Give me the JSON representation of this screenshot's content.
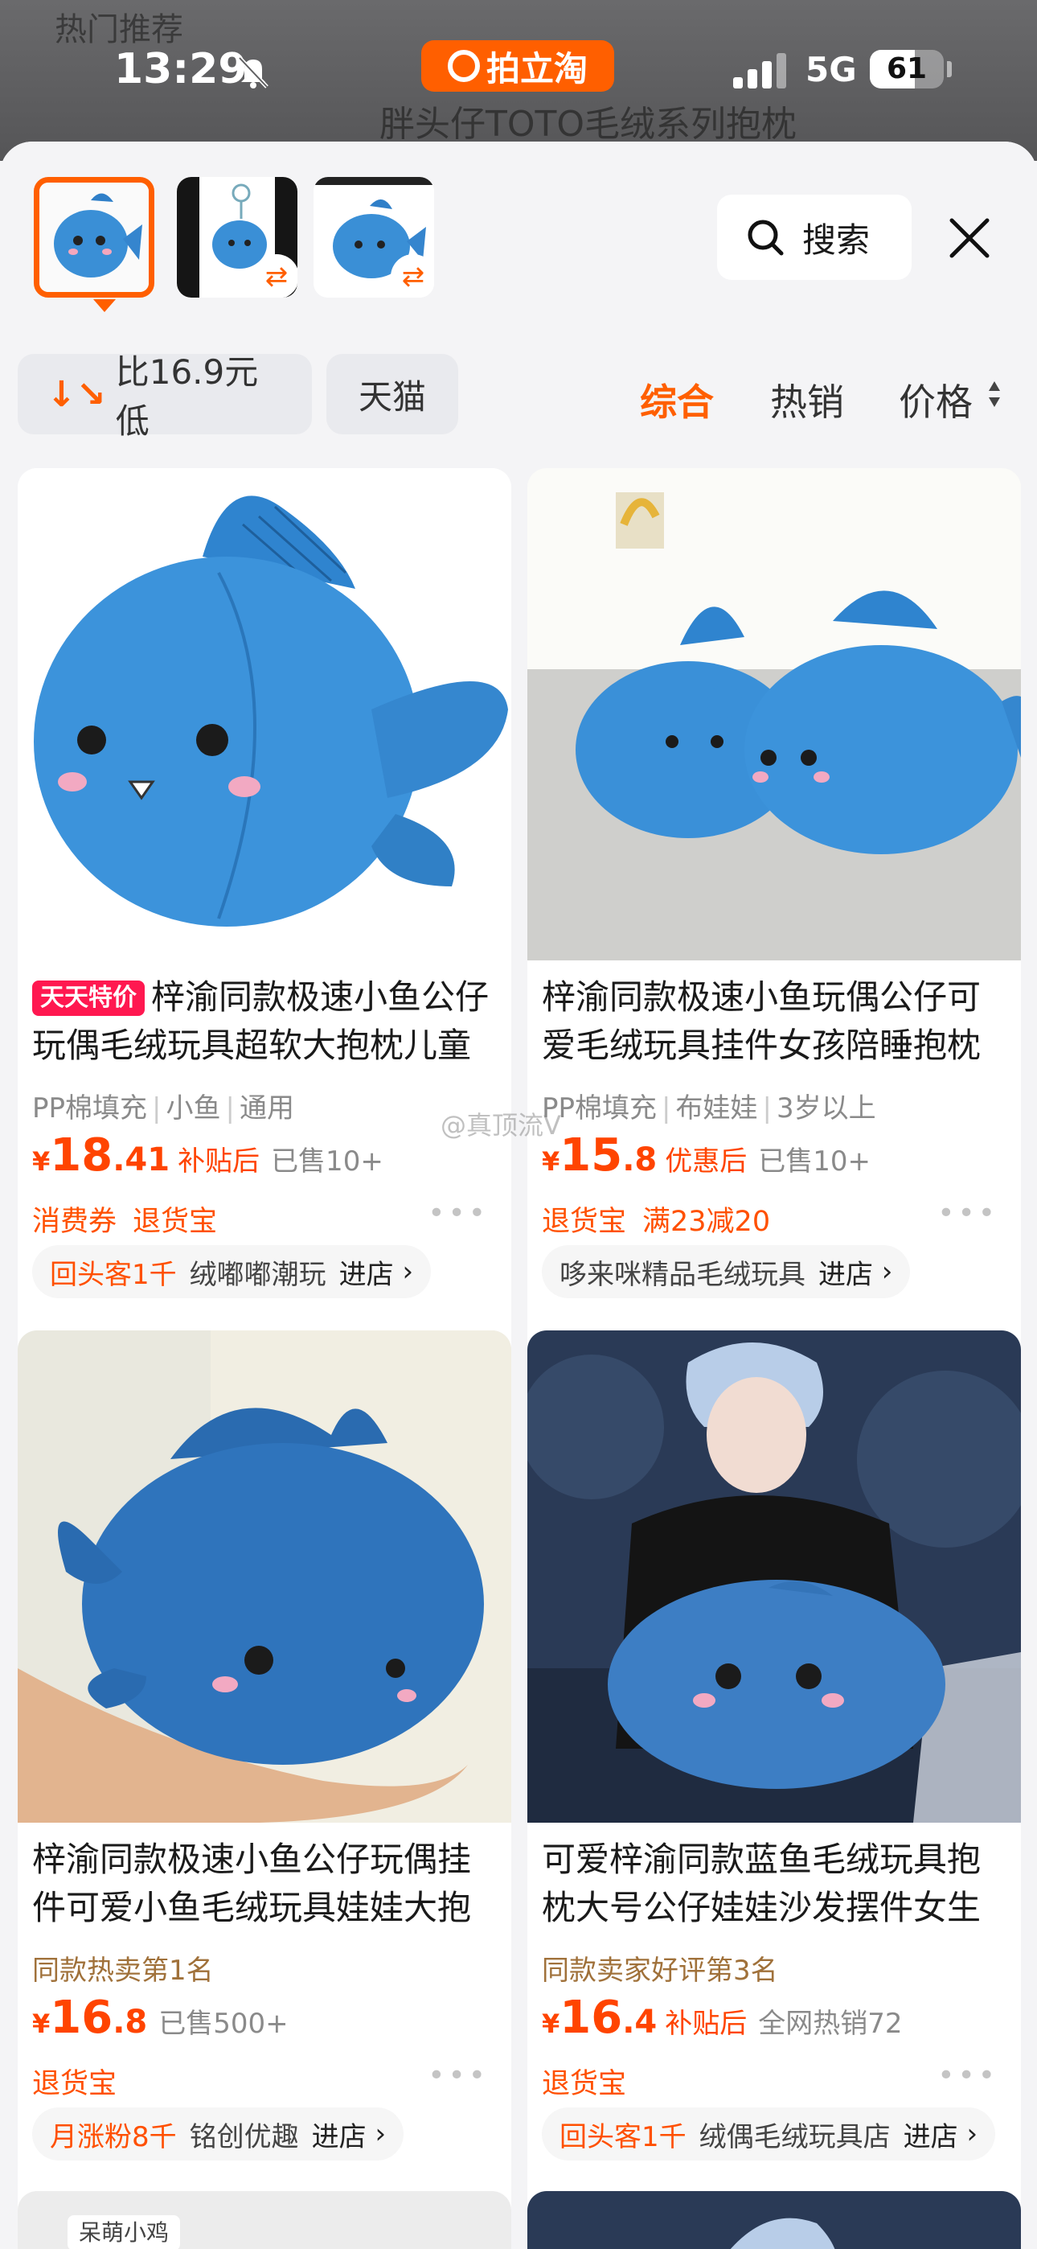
{
  "backdrop": {
    "hint": "热门推荐",
    "title": "胖头仔TOTO毛绒系列抱枕"
  },
  "status_bar": {
    "time": "13:29",
    "app_name": "拍立淘",
    "network": "5G",
    "battery": "61",
    "battery_level": 0.61
  },
  "header": {
    "search_label": "搜索",
    "thumb_count": 3
  },
  "filters": {
    "price_chip": "比16.9元低",
    "tmall_chip": "天猫",
    "sort_options": [
      "综合",
      "热销",
      "价格"
    ],
    "active_sort": "综合"
  },
  "products": [
    {
      "promo_tag": "天天特价",
      "title": "梓渝同款极速小鱼公仔玩偶毛绒玩具超软大抱枕儿童",
      "attrs": [
        "PP棉填充",
        "小鱼",
        "通用"
      ],
      "currency": "¥",
      "price_int": "18",
      "price_dec": ".41",
      "price_note": "补贴后",
      "sold": "已售10+",
      "services": [
        "消费券",
        "退货宝"
      ],
      "shop_tag": "回头客1千",
      "shop_name": "绒嘟嘟潮玩",
      "enter": "进店"
    },
    {
      "promo_tag": "",
      "title": "梓渝同款极速小鱼玩偶公仔可爱毛绒玩具挂件女孩陪睡抱枕",
      "attrs": [
        "PP棉填充",
        "布娃娃",
        "3岁以上"
      ],
      "currency": "¥",
      "price_int": "15",
      "price_dec": ".8",
      "price_note": "优惠后",
      "sold": "已售10+",
      "services": [
        "退货宝",
        "满23减20"
      ],
      "shop_tag": "",
      "shop_name": "哆来咪精品毛绒玩具",
      "enter": "进店"
    },
    {
      "promo_tag": "",
      "title": "梓渝同款极速小鱼公仔玩偶挂件可爱小鱼毛绒玩具娃娃大抱",
      "highlight": "同款热卖第1名",
      "currency": "¥",
      "price_int": "16",
      "price_dec": ".8",
      "price_note": "",
      "sold": "已售500+",
      "services": [
        "退货宝"
      ],
      "shop_tag": "月涨粉8千",
      "shop_name": "铭创优趣",
      "enter": "进店"
    },
    {
      "promo_tag": "",
      "title": "可爱梓渝同款蓝鱼毛绒玩具抱枕大号公仔娃娃沙发摆件女生",
      "highlight": "同款卖家好评第3名",
      "currency": "¥",
      "price_int": "16",
      "price_dec": ".4",
      "price_note": "补贴后",
      "sold": "全网热销72",
      "services": [
        "退货宝"
      ],
      "shop_tag": "回头客1千",
      "shop_name": "绒偶毛绒玩具店",
      "enter": "进店"
    }
  ],
  "next_row": {
    "partial_label": "呆萌小鸡"
  },
  "watermark": "@真顶流V",
  "colors": {
    "accent": "#ff5f00",
    "price": "#ff4400",
    "promo": "#ff1850",
    "fish": "#3a8fd6"
  }
}
